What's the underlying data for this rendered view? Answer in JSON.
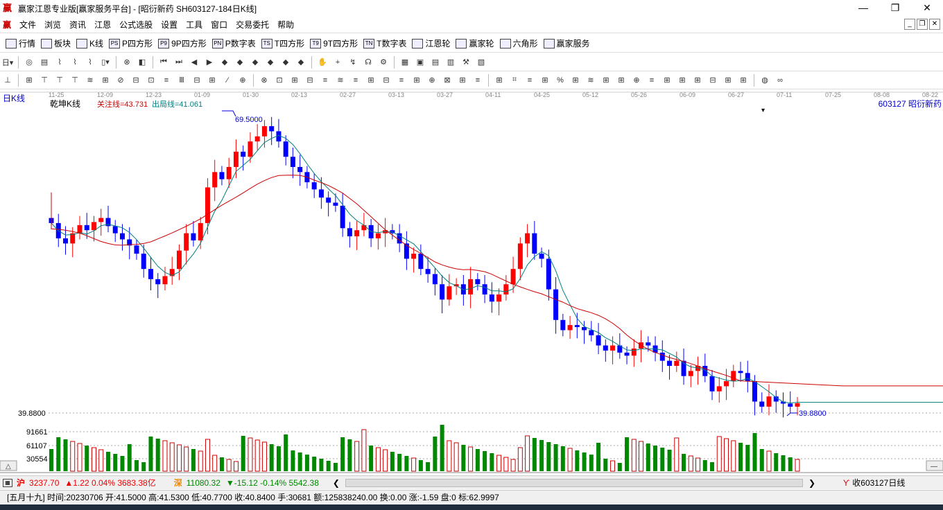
{
  "window": {
    "app_icon": "赢",
    "title": "赢家江恩专业版[赢家服务平台] - [昭衍新药  SH603127-184日K线]",
    "minimize": "—",
    "restore": "❐",
    "close": "✕"
  },
  "menu": {
    "icon": "赢",
    "items": [
      "文件",
      "浏览",
      "资讯",
      "江恩",
      "公式选股",
      "设置",
      "工具",
      "窗口",
      "交易委托",
      "帮助"
    ]
  },
  "toolbar1": [
    {
      "label": "行情",
      "icon": "grid-icon"
    },
    {
      "label": "板块",
      "icon": "blocks-icon"
    },
    {
      "label": "K线",
      "icon": "candles-icon"
    },
    {
      "label": "P四方形",
      "icon": "ps-icon",
      "tag": "PS"
    },
    {
      "label": "9P四方形",
      "icon": "p9-icon",
      "tag": "P9"
    },
    {
      "label": "P数字表",
      "icon": "pn-icon",
      "tag": "PN"
    },
    {
      "label": "T四方形",
      "icon": "ts-icon",
      "tag": "TS"
    },
    {
      "label": "9T四方形",
      "icon": "t9-icon",
      "tag": "T9"
    },
    {
      "label": "T数字表",
      "icon": "tn-icon",
      "tag": "TN"
    },
    {
      "label": "江恩轮",
      "icon": "wheel-icon"
    },
    {
      "label": "赢家轮",
      "icon": "wheel2-icon"
    },
    {
      "label": "六角形",
      "icon": "hexagon-icon"
    },
    {
      "label": "赢家服务",
      "icon": "dollar-icon"
    }
  ],
  "chart": {
    "period_label": "日K线",
    "indicator_name": "乾坤K线",
    "focus_line": "关注线=43.731",
    "exit_line": "出局线=41.061",
    "stock_label": "603127  昭衍新药",
    "date_ticks": [
      "11-25",
      "12-09",
      "12-23",
      "01-09",
      "01-30",
      "02-13",
      "02-27",
      "03-13",
      "03-27",
      "04-11",
      "04-25",
      "05-12",
      "05-26",
      "06-09",
      "06-27",
      "07-11",
      "07-25",
      "08-08",
      "08-22"
    ],
    "high_annotation": "69.5000",
    "low_annotation": "39.8800",
    "price_axis_label": "39.8800",
    "volume_axis_labels": [
      "91661",
      "61107",
      "30554"
    ]
  },
  "chart_data": {
    "type": "candlestick",
    "title": "昭衍新药 SH603127 日K线",
    "high": 69.5,
    "low": 39.88,
    "closes": [
      58.5,
      57.0,
      56.5,
      57.5,
      58.3,
      57.8,
      58.6,
      59.0,
      58.2,
      57.5,
      56.9,
      56.3,
      55.5,
      54.0,
      53.0,
      52.5,
      53.3,
      54.0,
      55.8,
      57.5,
      56.8,
      58.5,
      62.0,
      63.5,
      62.8,
      64.0,
      65.5,
      65.0,
      66.5,
      67.0,
      68.0,
      67.5,
      66.5,
      65.0,
      64.0,
      63.5,
      62.5,
      61.8,
      61.0,
      60.5,
      60.2,
      58.0,
      57.2,
      57.8,
      58.3,
      57.0,
      57.5,
      57.8,
      57.5,
      56.5,
      55.0,
      55.5,
      54.0,
      53.5,
      52.5,
      51.0,
      52.3,
      52.5,
      51.5,
      53.0,
      52.5,
      51.5,
      50.8,
      51.5,
      52.5,
      54.0,
      56.5,
      57.5,
      55.5,
      55.0,
      52.0,
      49.0,
      48.0,
      48.5,
      48.3,
      48.0,
      47.5,
      46.5,
      46.0,
      46.5,
      45.8,
      45.5,
      46.2,
      46.8,
      46.5,
      45.8,
      45.0,
      44.5,
      45.0,
      43.5,
      44.0,
      44.5,
      43.5,
      42.0,
      42.5,
      43.0,
      44.0,
      43.8,
      43.0,
      41.0,
      40.5,
      41.5,
      41.0,
      40.8,
      40.5,
      40.84
    ],
    "volume_marks": [
      30554,
      61107,
      91661
    ],
    "series": [
      {
        "name": "关注线",
        "value": 43.731
      },
      {
        "name": "出局线",
        "value": 41.061
      }
    ]
  },
  "status1": {
    "index1": "3237.70",
    "index1_change": "▲1.22 0.04% 3683.38亿",
    "index2": "11080.32",
    "index2_change": "▼-15.12 -0.14% 5542.38",
    "right_label": "收603127日线"
  },
  "status2": {
    "text": "[五月十九] 时间:20230706 开:41.5000 高:41.5300 低:40.7700 收:40.8400 手:30681 额:125838240.00 换:0.00 涨:-1.59 盘:0 标:62.9997"
  },
  "colors": {
    "up": "#ff0000",
    "down": "#0000ff",
    "ma": "#008080",
    "ma_long": "#cc0000",
    "vol_up": "#cc0000",
    "vol_down": "#008800"
  }
}
